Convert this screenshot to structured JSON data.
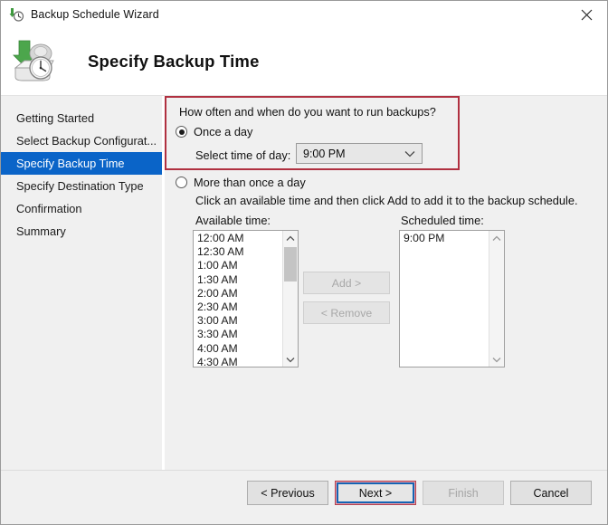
{
  "window": {
    "title": "Backup Schedule Wizard",
    "title_icon": "backup-clock-icon",
    "close_icon": "close-icon"
  },
  "header": {
    "title": "Specify Backup Time",
    "icon": "backup-disk-clock-icon"
  },
  "sidebar": {
    "items": [
      {
        "label": "Getting Started",
        "selected": false
      },
      {
        "label": "Select Backup Configurat...",
        "selected": false
      },
      {
        "label": "Specify Backup Time",
        "selected": true
      },
      {
        "label": "Specify Destination Type",
        "selected": false
      },
      {
        "label": "Confirmation",
        "selected": false
      },
      {
        "label": "Summary",
        "selected": false
      }
    ],
    "selected_color": "#0a64c8"
  },
  "main": {
    "question": "How often and when do you want to run backups?",
    "once_a_day": {
      "label": "Once a day",
      "checked": true,
      "time_label": "Select time of day:",
      "time_value": "9:00 PM",
      "dropdown_icon": "chevron-down-icon"
    },
    "more_than_once": {
      "label": "More than once a day",
      "checked": false,
      "hint": "Click an available time and then click Add to add it to the backup schedule."
    },
    "available": {
      "caption": "Available time:",
      "items": [
        "12:00 AM",
        "12:30 AM",
        "1:00 AM",
        "1:30 AM",
        "2:00 AM",
        "2:30 AM",
        "3:00 AM",
        "3:30 AM",
        "4:00 AM",
        "4:30 AM"
      ],
      "scroll_up_icon": "chevron-up-icon",
      "scroll_down_icon": "chevron-down-icon"
    },
    "scheduled": {
      "caption": "Scheduled time:",
      "items": [
        "9:00 PM"
      ],
      "scroll_up_icon": "chevron-up-icon",
      "scroll_down_icon": "chevron-down-icon"
    },
    "add_button": "Add >",
    "remove_button": "< Remove",
    "annotation_color": "#b03040"
  },
  "footer": {
    "previous": "< Previous",
    "next": "Next >",
    "finish": "Finish",
    "cancel": "Cancel"
  }
}
